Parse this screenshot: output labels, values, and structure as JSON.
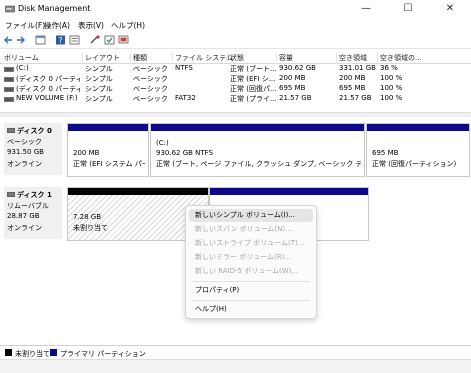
{
  "window": {
    "title": "Disk Management",
    "minimize": "—",
    "maximize": "☐",
    "close": "✕"
  },
  "menu": [
    "ファイル(F)",
    "操作(A)",
    "表示(V)",
    "ヘルプ(H)"
  ],
  "toolbar_icons": [
    "back-icon",
    "forward-icon",
    "list-icon",
    "help-icon",
    "properties-icon",
    "connect-icon",
    "check-icon",
    "monitor-icon"
  ],
  "table": {
    "headers": [
      "ボリューム",
      "レイアウト",
      "種類",
      "ファイル システム",
      "状態",
      "容量",
      "空き領域",
      "空き領域の..."
    ],
    "rows": [
      [
        "(C:)",
        "シンプル",
        "ベーシック",
        "NTFS",
        "正常 (ブート...",
        "930.62 GB",
        "331.01 GB",
        "36 %"
      ],
      [
        "(ディスク 0 パーティショ...",
        "シンプル",
        "ベーシック",
        "",
        "正常 (EFI シ...",
        "200 MB",
        "200 MB",
        "100 %"
      ],
      [
        "(ディスク 0 パーティショ...",
        "シンプル",
        "ベーシック",
        "",
        "正常 (回復パ...",
        "695 MB",
        "695 MB",
        "100 %"
      ],
      [
        "NEW VOLUME (F:)",
        "シンプル",
        "ベーシック",
        "FAT32",
        "正常 (プライ...",
        "21.57 GB",
        "21.57 GB",
        "100 %"
      ]
    ]
  },
  "disk0": {
    "name": "ディスク 0",
    "type": "ベーシック",
    "size": "931.50 GB",
    "status": "オンライン",
    "partitions": [
      {
        "line1": "",
        "line2": "200 MB",
        "line3": "正常 (EFI システム パーティ"
      },
      {
        "line1": "(C:)",
        "line2": "930.62 GB NTFS",
        "line3": "正常 (ブート, ページ ファイル, クラッシュ ダンプ, ベーシック データ パーティション)"
      },
      {
        "line1": "",
        "line2": "695 MB",
        "line3": "正常 (回復パーティション)"
      }
    ]
  },
  "disk1": {
    "name": "ディスク 1",
    "type": "リムーバブル",
    "size": "28.87 GB",
    "status": "オンライン",
    "unallocated": {
      "size": "7.28 GB",
      "label": "未割り当て"
    }
  },
  "context_menu": [
    {
      "label": "新しいシンプル ボリューム(I)...",
      "enabled": true
    },
    {
      "label": "新しいスパン ボリューム(N)...",
      "enabled": false
    },
    {
      "label": "新しいストライプ ボリューム(T)...",
      "enabled": false
    },
    {
      "label": "新しいミラー ボリューム(R)...",
      "enabled": false
    },
    {
      "label": "新しい RAID-5 ボリューム(W)...",
      "enabled": false
    },
    {
      "label": "プロパティ(P)",
      "enabled": true
    },
    {
      "label": "ヘルプ(H)",
      "enabled": true
    }
  ],
  "legend": {
    "unallocated": "未割り当て",
    "primary": "プライマリ パーティション",
    "unallocated_color": "#000000",
    "primary_color": "#0a0a8a"
  }
}
